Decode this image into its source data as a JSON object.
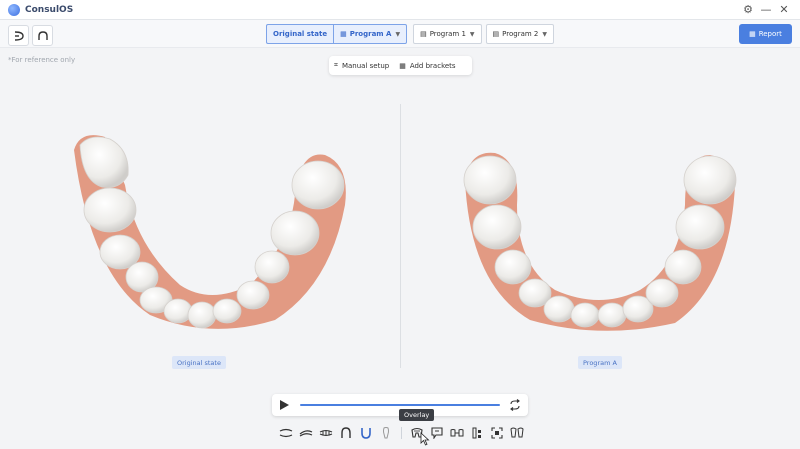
{
  "app": {
    "title": "ConsulOS"
  },
  "tabs": {
    "original": "Original state",
    "program_a": "Program A",
    "program_1": "Program 1",
    "program_2": "Program 2"
  },
  "report_label": "Report",
  "reference_note": "*For reference only",
  "setup": {
    "manual": "Manual setup",
    "brackets": "Add brackets"
  },
  "views": {
    "left_label": "Original state",
    "right_label": "Program A"
  },
  "tooltip": "Overlay",
  "colors": {
    "accent": "#4a7fe0",
    "gum": "#e59a82",
    "tooth": "#f6f4f2"
  },
  "icons": [
    "settings-icon",
    "minimize-icon",
    "close-icon",
    "undo-icon",
    "upper-arch-icon",
    "play-icon",
    "loop-icon"
  ]
}
